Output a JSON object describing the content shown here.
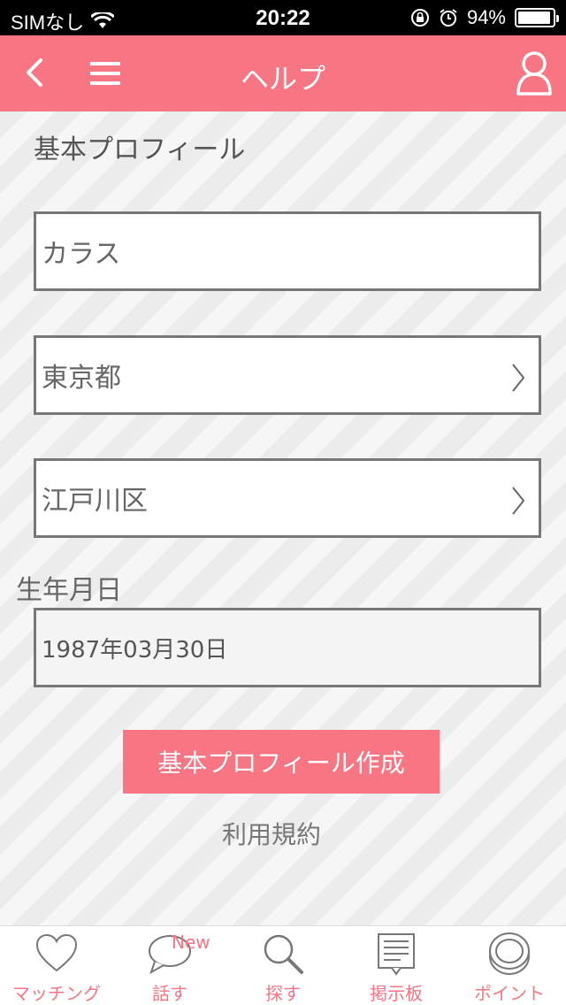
{
  "status_bar": {
    "carrier": "SIMなし",
    "time": "20:22",
    "battery": "94%",
    "battery_level": 0.94
  },
  "nav": {
    "title": "ヘルプ",
    "icons": [
      "back-icon",
      "menu-icon",
      "user-icon"
    ]
  },
  "form": {
    "section_title": "基本プロフィール",
    "nickname_value": "カラス",
    "prefecture_value": "東京都",
    "city_value": "江戸川区",
    "dob_label": "生年月日",
    "dob_value": "1987年03月30日",
    "submit_label": "基本プロフィール作成",
    "terms_link": "利用規約"
  },
  "tabs": [
    {
      "label": "マッチング",
      "icon": "heart-icon"
    },
    {
      "label": "話す",
      "icon": "chat-bubble-icon",
      "badge": "New"
    },
    {
      "label": "探す",
      "icon": "search-icon"
    },
    {
      "label": "掲示板",
      "icon": "bulletin-board-icon"
    },
    {
      "label": "ポイント",
      "icon": "coin-icon"
    }
  ],
  "colors": {
    "accent": "#f87683",
    "status_bar": "#000000",
    "field_border": "#777777"
  }
}
